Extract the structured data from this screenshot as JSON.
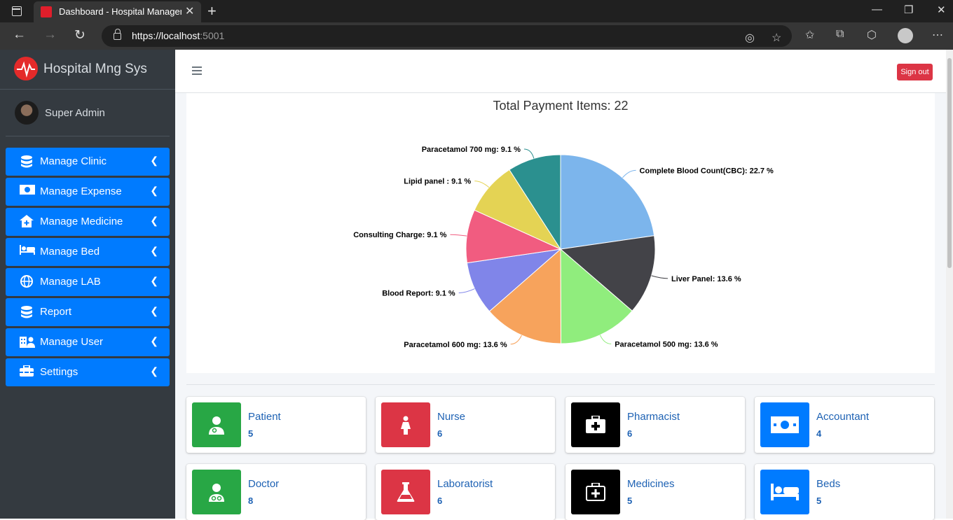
{
  "browser": {
    "tab_title": "Dashboard - Hospital Manageme",
    "url_host": "https://localhost",
    "url_port": ":5001"
  },
  "sidebar": {
    "brand": "Hospital Mng Sys",
    "user": "Super Admin",
    "items": [
      {
        "label": "Manage Clinic",
        "icon": "database-icon"
      },
      {
        "label": "Manage Expense",
        "icon": "money-icon"
      },
      {
        "label": "Manage Medicine",
        "icon": "clinic-icon"
      },
      {
        "label": "Manage Bed",
        "icon": "bed-icon"
      },
      {
        "label": "Manage LAB",
        "icon": "globe-icon"
      },
      {
        "label": "Report",
        "icon": "database-icon"
      },
      {
        "label": "Manage User",
        "icon": "users-icon"
      },
      {
        "label": "Settings",
        "icon": "toolbox-icon"
      }
    ]
  },
  "header": {
    "sign_out": "Sign out"
  },
  "chart_data": {
    "type": "pie",
    "title": "Total Payment Items: 22",
    "slices": [
      {
        "label": "Complete Blood Count(CBC)",
        "value": 22.7,
        "color": "#7cb5ec"
      },
      {
        "label": "Liver Panel",
        "value": 13.6,
        "color": "#434348"
      },
      {
        "label": "Paracetamol 500 mg",
        "value": 13.6,
        "color": "#90ed7d"
      },
      {
        "label": "Paracetamol 600 mg",
        "value": 13.6,
        "color": "#f7a35c"
      },
      {
        "label": "Blood Report",
        "value": 9.1,
        "color": "#8085e9"
      },
      {
        "label": "Consulting Charge",
        "value": 9.1,
        "color": "#f15c80"
      },
      {
        "label": "Lipid panel ",
        "value": 9.1,
        "color": "#e4d354"
      },
      {
        "label": "Paracetamol 700 mg",
        "value": 9.1,
        "color": "#2b908f"
      }
    ],
    "label_suffix": " %"
  },
  "stats": [
    {
      "label": "Patient",
      "count": "5",
      "color": "#28a745",
      "icon": "doctor-icon"
    },
    {
      "label": "Nurse",
      "count": "6",
      "color": "#dc3545",
      "icon": "female-icon"
    },
    {
      "label": "Pharmacist",
      "count": "6",
      "color": "#000000",
      "icon": "medkit-icon"
    },
    {
      "label": "Accountant",
      "count": "4",
      "color": "#007bff",
      "icon": "money-icon"
    },
    {
      "label": "Doctor",
      "count": "8",
      "color": "#28a745",
      "icon": "user-md-icon"
    },
    {
      "label": "Laboratorist",
      "count": "6",
      "color": "#dc3545",
      "icon": "flask-icon"
    },
    {
      "label": "Medicines",
      "count": "5",
      "color": "#000000",
      "icon": "first-aid-icon"
    },
    {
      "label": "Beds",
      "count": "5",
      "color": "#007bff",
      "icon": "bed-icon"
    }
  ]
}
